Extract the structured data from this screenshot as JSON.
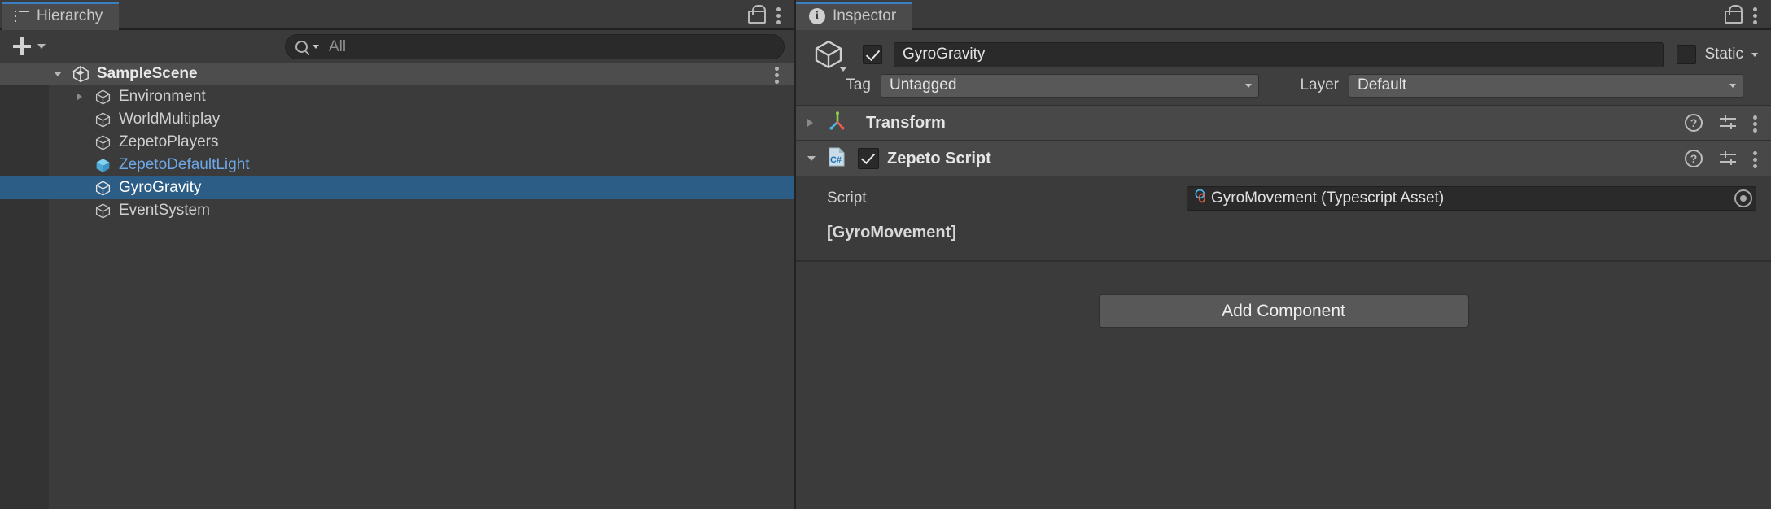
{
  "hierarchy": {
    "tab_label": "Hierarchy",
    "tab_icon": "hierarchy-list-icon",
    "lock_icon": "lock-open-icon",
    "menu_icon": "kebab-menu-icon",
    "create_button_label": "+",
    "create_dropdown_icon": "chevron-down-icon",
    "search": {
      "icon": "search-icon",
      "placeholder": "All",
      "value": ""
    },
    "scene": {
      "name": "SampleScene",
      "icon": "unity-scene-icon",
      "expanded": true,
      "row_menu_icon": "kebab-menu-icon"
    },
    "objects": [
      {
        "name": "Environment",
        "icon": "gameobject-cube-icon",
        "has_children": true,
        "selected": false,
        "prefab": false
      },
      {
        "name": "WorldMultiplay",
        "icon": "gameobject-cube-icon",
        "has_children": false,
        "selected": false,
        "prefab": false
      },
      {
        "name": "ZepetoPlayers",
        "icon": "gameobject-cube-icon",
        "has_children": false,
        "selected": false,
        "prefab": false
      },
      {
        "name": "ZepetoDefaultLight",
        "icon": "prefab-cube-icon",
        "has_children": false,
        "selected": false,
        "prefab": true
      },
      {
        "name": "GyroGravity",
        "icon": "gameobject-cube-icon",
        "has_children": false,
        "selected": true,
        "prefab": false
      },
      {
        "name": "EventSystem",
        "icon": "gameobject-cube-icon",
        "has_children": false,
        "selected": false,
        "prefab": false
      }
    ]
  },
  "inspector": {
    "tab_label": "Inspector",
    "tab_icon": "info-icon",
    "lock_icon": "lock-open-icon",
    "menu_icon": "kebab-menu-icon",
    "gameobject": {
      "icon": "gameobject-cube-icon",
      "enabled": true,
      "name": "GyroGravity",
      "static_label": "Static",
      "static_checked": false,
      "static_dropdown_icon": "chevron-down-icon",
      "tag_label": "Tag",
      "tag_value": "Untagged",
      "layer_label": "Layer",
      "layer_value": "Default"
    },
    "components": [
      {
        "title": "Transform",
        "icon": "transform-axis-icon",
        "expanded": false,
        "has_checkbox": false,
        "enabled": true,
        "help_icon": "help-icon",
        "preset_icon": "preset-settings-icon",
        "menu_icon": "kebab-menu-icon"
      },
      {
        "title": "Zepeto Script",
        "icon": "csharp-script-icon",
        "expanded": true,
        "has_checkbox": true,
        "enabled": true,
        "help_icon": "help-icon",
        "preset_icon": "preset-settings-icon",
        "menu_icon": "kebab-menu-icon",
        "script_field_label": "Script",
        "script_field_value": "GyroMovement (Typescript Asset)",
        "script_field_icon": "typescript-asset-icon",
        "script_picker_icon": "object-picker-icon",
        "script_note": "[GyroMovement]"
      }
    ],
    "add_component_label": "Add Component"
  },
  "colors": {
    "selection_blue": "#2c5d87",
    "tab_accent": "#3b7ec4",
    "panel_bg": "#3b3b3b",
    "header_bg": "#484848",
    "field_bg": "#2a2a2a",
    "prefab_blue": "#6da8e8"
  }
}
